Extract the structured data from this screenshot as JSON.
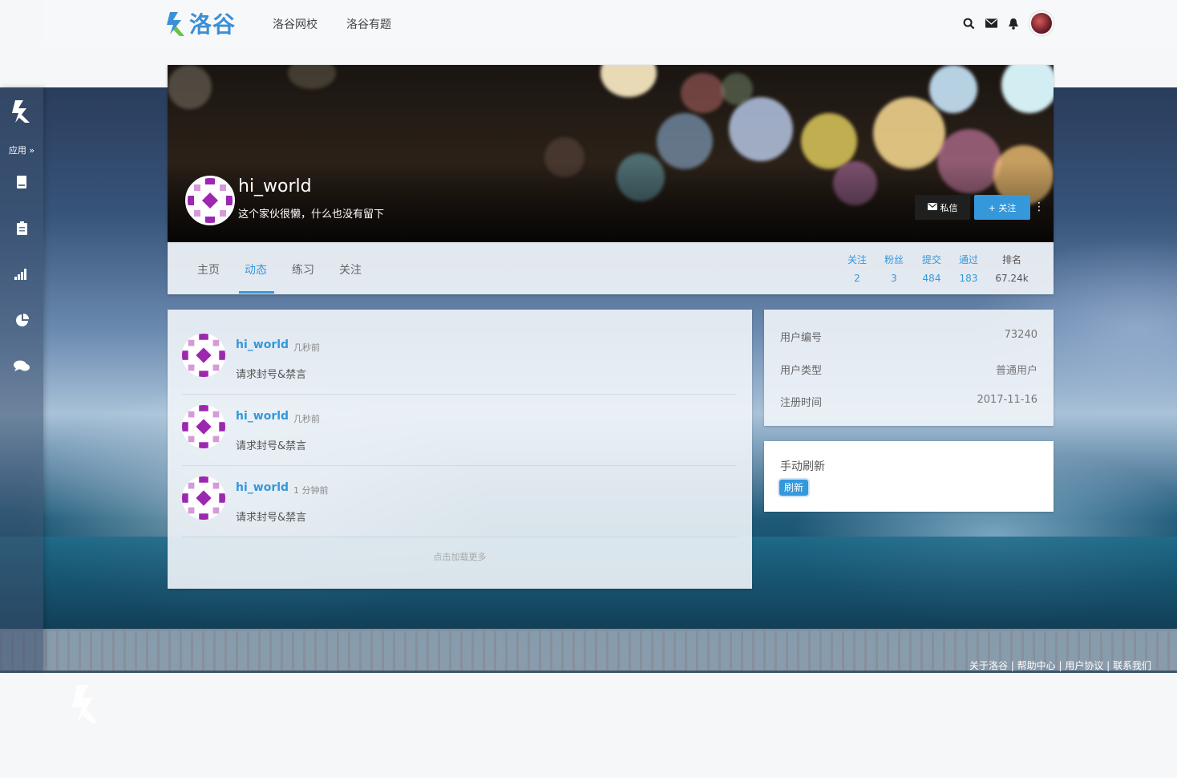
{
  "topnav": {
    "logo_text": "洛谷",
    "links": [
      "洛谷网校",
      "洛谷有题"
    ]
  },
  "sidebar": {
    "apps_label": "应用 »",
    "items": [
      "book-icon",
      "clipboard-icon",
      "signal-bars-icon",
      "pie-chart-icon",
      "comments-icon"
    ]
  },
  "profile": {
    "username": "hi_world",
    "bio": "这个家伙很懒，什么也没有留下",
    "message_button": "私信",
    "follow_button": "+ 关注",
    "more_button": "⋮"
  },
  "tabs": [
    {
      "label": "主页",
      "active": false
    },
    {
      "label": "动态",
      "active": true
    },
    {
      "label": "练习",
      "active": false
    },
    {
      "label": "关注",
      "active": false
    }
  ],
  "stats": [
    {
      "label": "关注",
      "value": "2"
    },
    {
      "label": "粉丝",
      "value": "3"
    },
    {
      "label": "提交",
      "value": "484"
    },
    {
      "label": "通过",
      "value": "183"
    },
    {
      "label": "排名",
      "value": "67.24k"
    }
  ],
  "feed": {
    "items": [
      {
        "name": "hi_world",
        "time": "几秒前",
        "text": "请求封号&禁言"
      },
      {
        "name": "hi_world",
        "time": "几秒前",
        "text": "请求封号&禁言"
      },
      {
        "name": "hi_world",
        "time": "1 分钟前",
        "text": "请求封号&禁言"
      }
    ],
    "load_more": "点击加载更多"
  },
  "info": {
    "rows": [
      {
        "label": "用户编号",
        "value": "73240"
      },
      {
        "label": "用户类型",
        "value": "普通用户"
      },
      {
        "label": "注册时间",
        "value": "2017-11-16"
      }
    ]
  },
  "refresh": {
    "title": "手动刷新",
    "button": "刷新"
  },
  "footer": {
    "links": "关于洛谷 | 帮助中心 | 用户协议 | 联系我们"
  },
  "colors": {
    "accent": "#3498db",
    "brand": "#3b8fd6"
  }
}
